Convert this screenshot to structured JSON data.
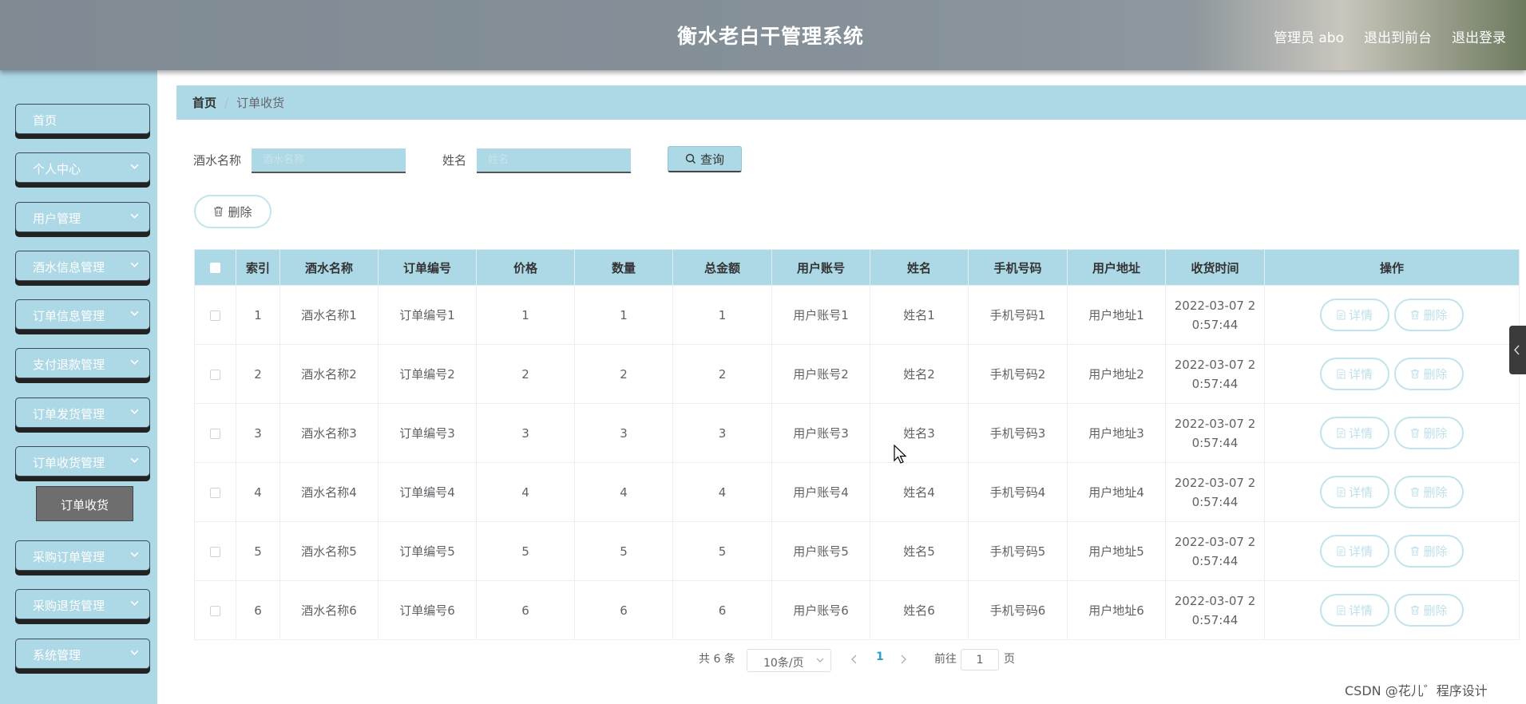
{
  "header": {
    "title": "衡水老白干管理系统",
    "admin": "管理员 abo",
    "to_front": "退出到前台",
    "logout": "退出登录"
  },
  "sidebar": {
    "items": [
      {
        "label": "首页",
        "has_arrow": false
      },
      {
        "label": "个人中心",
        "has_arrow": true
      },
      {
        "label": "用户管理",
        "has_arrow": true
      },
      {
        "label": "酒水信息管理",
        "has_arrow": true
      },
      {
        "label": "订单信息管理",
        "has_arrow": true
      },
      {
        "label": "支付退款管理",
        "has_arrow": true
      },
      {
        "label": "订单发货管理",
        "has_arrow": true
      },
      {
        "label": "订单收货管理",
        "has_arrow": true
      },
      {
        "label": "采购订单管理",
        "has_arrow": true
      },
      {
        "label": "采购退货管理",
        "has_arrow": true
      },
      {
        "label": "系统管理",
        "has_arrow": true
      }
    ],
    "active_submenu": "订单收货"
  },
  "breadcrumb": {
    "home": "首页",
    "current": "订单收货"
  },
  "search": {
    "field1_label": "酒水名称",
    "field1_placeholder": "酒水名称",
    "field2_label": "姓名",
    "field2_placeholder": "姓名",
    "query_label": "查询"
  },
  "actions": {
    "delete_label": "删除"
  },
  "table": {
    "headers": [
      "索引",
      "酒水名称",
      "订单编号",
      "价格",
      "数量",
      "总金额",
      "用户账号",
      "姓名",
      "手机号码",
      "用户地址",
      "收货时间",
      "操作"
    ],
    "rows": [
      {
        "index": "1",
        "name": "酒水名称1",
        "order_no": "订单编号1",
        "price": "1",
        "qty": "1",
        "total": "1",
        "account": "用户账号1",
        "person": "姓名1",
        "phone": "手机号码1",
        "address": "用户地址1",
        "time_line1": "2022-03-07 2",
        "time_line2": "0:57:44"
      },
      {
        "index": "2",
        "name": "酒水名称2",
        "order_no": "订单编号2",
        "price": "2",
        "qty": "2",
        "total": "2",
        "account": "用户账号2",
        "person": "姓名2",
        "phone": "手机号码2",
        "address": "用户地址2",
        "time_line1": "2022-03-07 2",
        "time_line2": "0:57:44"
      },
      {
        "index": "3",
        "name": "酒水名称3",
        "order_no": "订单编号3",
        "price": "3",
        "qty": "3",
        "total": "3",
        "account": "用户账号3",
        "person": "姓名3",
        "phone": "手机号码3",
        "address": "用户地址3",
        "time_line1": "2022-03-07 2",
        "time_line2": "0:57:44"
      },
      {
        "index": "4",
        "name": "酒水名称4",
        "order_no": "订单编号4",
        "price": "4",
        "qty": "4",
        "total": "4",
        "account": "用户账号4",
        "person": "姓名4",
        "phone": "手机号码4",
        "address": "用户地址4",
        "time_line1": "2022-03-07 2",
        "time_line2": "0:57:44"
      },
      {
        "index": "5",
        "name": "酒水名称5",
        "order_no": "订单编号5",
        "price": "5",
        "qty": "5",
        "total": "5",
        "account": "用户账号5",
        "person": "姓名5",
        "phone": "手机号码5",
        "address": "用户地址5",
        "time_line1": "2022-03-07 2",
        "time_line2": "0:57:44"
      },
      {
        "index": "6",
        "name": "酒水名称6",
        "order_no": "订单编号6",
        "price": "6",
        "qty": "6",
        "total": "6",
        "account": "用户账号6",
        "person": "姓名6",
        "phone": "手机号码6",
        "address": "用户地址6",
        "time_line1": "2022-03-07 2",
        "time_line2": "0:57:44"
      }
    ],
    "detail_label": "详情",
    "row_delete_label": "删除"
  },
  "pagination": {
    "total_text": "共 6 条",
    "page_size": "10条/页",
    "current_page": "1",
    "goto_prefix": "前往",
    "goto_value": "1",
    "goto_suffix": "页"
  },
  "watermark": "CSDN @花儿゛程序设计",
  "icons": {
    "search": "search-icon",
    "trash": "trash-icon",
    "doc": "document-icon",
    "chevron": "chevron-down-icon"
  },
  "colors": {
    "accent": "#add8e6",
    "header": "#86919a",
    "submenu_active": "#6f6e6e"
  }
}
